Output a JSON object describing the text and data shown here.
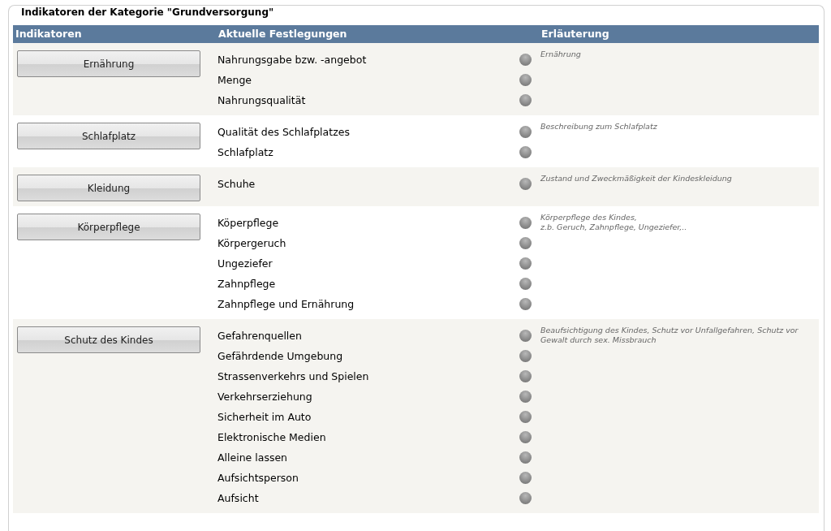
{
  "fieldset": {
    "legend": "Indikatoren der Kategorie \"Grundversorgung\""
  },
  "table": {
    "columns": [
      "Indikatoren",
      "Aktuelle Festlegungen",
      "Erläuterung"
    ],
    "groups": [
      {
        "indicator": "Ernährung",
        "items": [
          "Nahrungsgabe bzw. -angebot",
          "Menge",
          "Nahrungsqualität"
        ],
        "description": "Ernährung"
      },
      {
        "indicator": "Schlafplatz",
        "items": [
          "Qualität des Schlafplatzes",
          "Schlafplatz"
        ],
        "description": "Beschreibung zum Schlafplatz"
      },
      {
        "indicator": "Kleidung",
        "items": [
          "Schuhe"
        ],
        "description": "Zustand und Zweckmäßigkeit der Kindeskleidung"
      },
      {
        "indicator": "Körperpflege",
        "items": [
          "Köperpflege",
          "Körpergeruch",
          "Ungeziefer",
          "Zahnpflege",
          "Zahnpflege und Ernährung"
        ],
        "description": "Körperpflege des Kindes,\nz.b. Geruch, Zahnpflege, Ungeziefer,.."
      },
      {
        "indicator": "Schutz des Kindes",
        "items": [
          "Gefahrenquellen",
          "Gefährdende Umgebung",
          "Strassenverkehrs und Spielen",
          "Verkehrserziehung",
          "Sicherheit im Auto",
          "Elektronische Medien",
          "Alleine lassen",
          "Aufsichtsperson",
          "Aufsicht"
        ],
        "description": "Beaufsichtigung des Kindes, Schutz vor Unfallgefahren, Schutz vor Gewalt durch sex. Missbrauch"
      }
    ]
  }
}
